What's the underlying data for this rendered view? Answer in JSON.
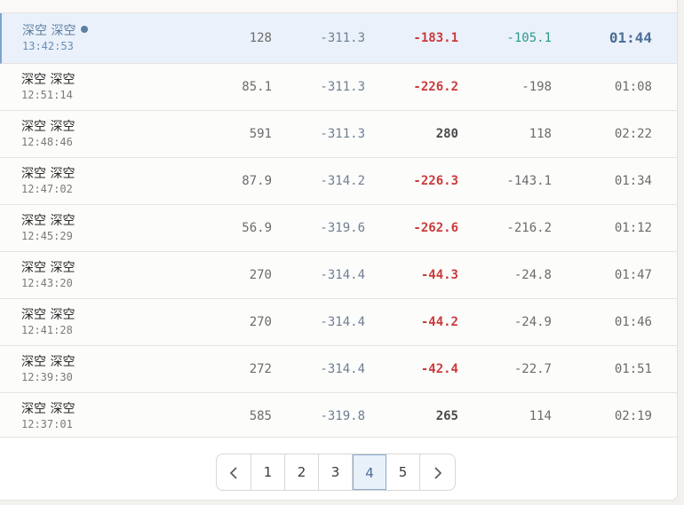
{
  "rows": [
    {
      "name": "深空 深空",
      "time": "13:42:53",
      "col1": "128",
      "col2": "-311.3",
      "col3": "-183.1",
      "col4": "-105.1",
      "col5": "01:44"
    },
    {
      "name": "深空 深空",
      "time": "12:51:14",
      "col1": "85.1",
      "col2": "-311.3",
      "col3": "-226.2",
      "col4": "-198",
      "col5": "01:08"
    },
    {
      "name": "深空 深空",
      "time": "12:48:46",
      "col1": "591",
      "col2": "-311.3",
      "col3": "280",
      "col4": "118",
      "col5": "02:22"
    },
    {
      "name": "深空 深空",
      "time": "12:47:02",
      "col1": "87.9",
      "col2": "-314.2",
      "col3": "-226.3",
      "col4": "-143.1",
      "col5": "01:34"
    },
    {
      "name": "深空 深空",
      "time": "12:45:29",
      "col1": "56.9",
      "col2": "-319.6",
      "col3": "-262.6",
      "col4": "-216.2",
      "col5": "01:12"
    },
    {
      "name": "深空 深空",
      "time": "12:43:20",
      "col1": "270",
      "col2": "-314.4",
      "col3": "-44.3",
      "col4": "-24.8",
      "col5": "01:47"
    },
    {
      "name": "深空 深空",
      "time": "12:41:28",
      "col1": "270",
      "col2": "-314.4",
      "col3": "-44.2",
      "col4": "-24.9",
      "col5": "01:46"
    },
    {
      "name": "深空 深空",
      "time": "12:39:30",
      "col1": "272",
      "col2": "-314.4",
      "col3": "-42.4",
      "col4": "-22.7",
      "col5": "01:51"
    },
    {
      "name": "深空 深空",
      "time": "12:37:01",
      "col1": "585",
      "col2": "-319.8",
      "col3": "265",
      "col4": "114",
      "col5": "02:19"
    }
  ],
  "pagination": {
    "prev_icon": "chevron-left-icon",
    "next_icon": "chevron-right-icon",
    "pages": [
      "1",
      "2",
      "3",
      "4",
      "5"
    ],
    "current": "4"
  },
  "colors": {
    "negative": "#cc3a3a",
    "teal": "#2a9a8a",
    "accent": "#4b6f96",
    "active_row_bg": "#eaf1fb"
  }
}
